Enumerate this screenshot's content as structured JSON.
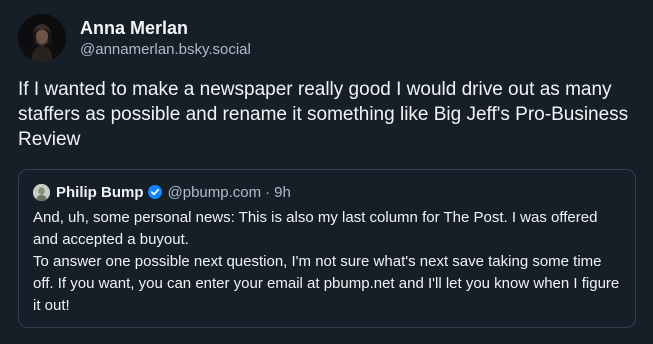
{
  "author": {
    "display_name": "Anna Merlan",
    "handle": "@annamerlan.bsky.social",
    "avatar_icon": "avatar-photo-icon"
  },
  "post": {
    "text": "If I wanted to make a newspaper really good I would drive out as many staffers as possible and rename it something like Big Jeff's Pro-Business Review"
  },
  "quote": {
    "display_name": "Philip Bump",
    "verified_icon": "verified-check-icon",
    "handle": "@pbump.com",
    "separator": "·",
    "time": "9h",
    "paragraphs": [
      "And, uh, some personal news: This is also my last column for The Post. I was offered and accepted a buyout.",
      "To answer one possible next question, I'm not sure what's next save taking some time off. If you want, you can enter your email at pbump.net and I'll let you know when I figure it out!"
    ]
  },
  "colors": {
    "background": "#161e27",
    "text": "#f1f3f5",
    "secondary_text": "#aebbc9",
    "quote_border": "#2e4052",
    "verified_blue": "#1185fe"
  }
}
